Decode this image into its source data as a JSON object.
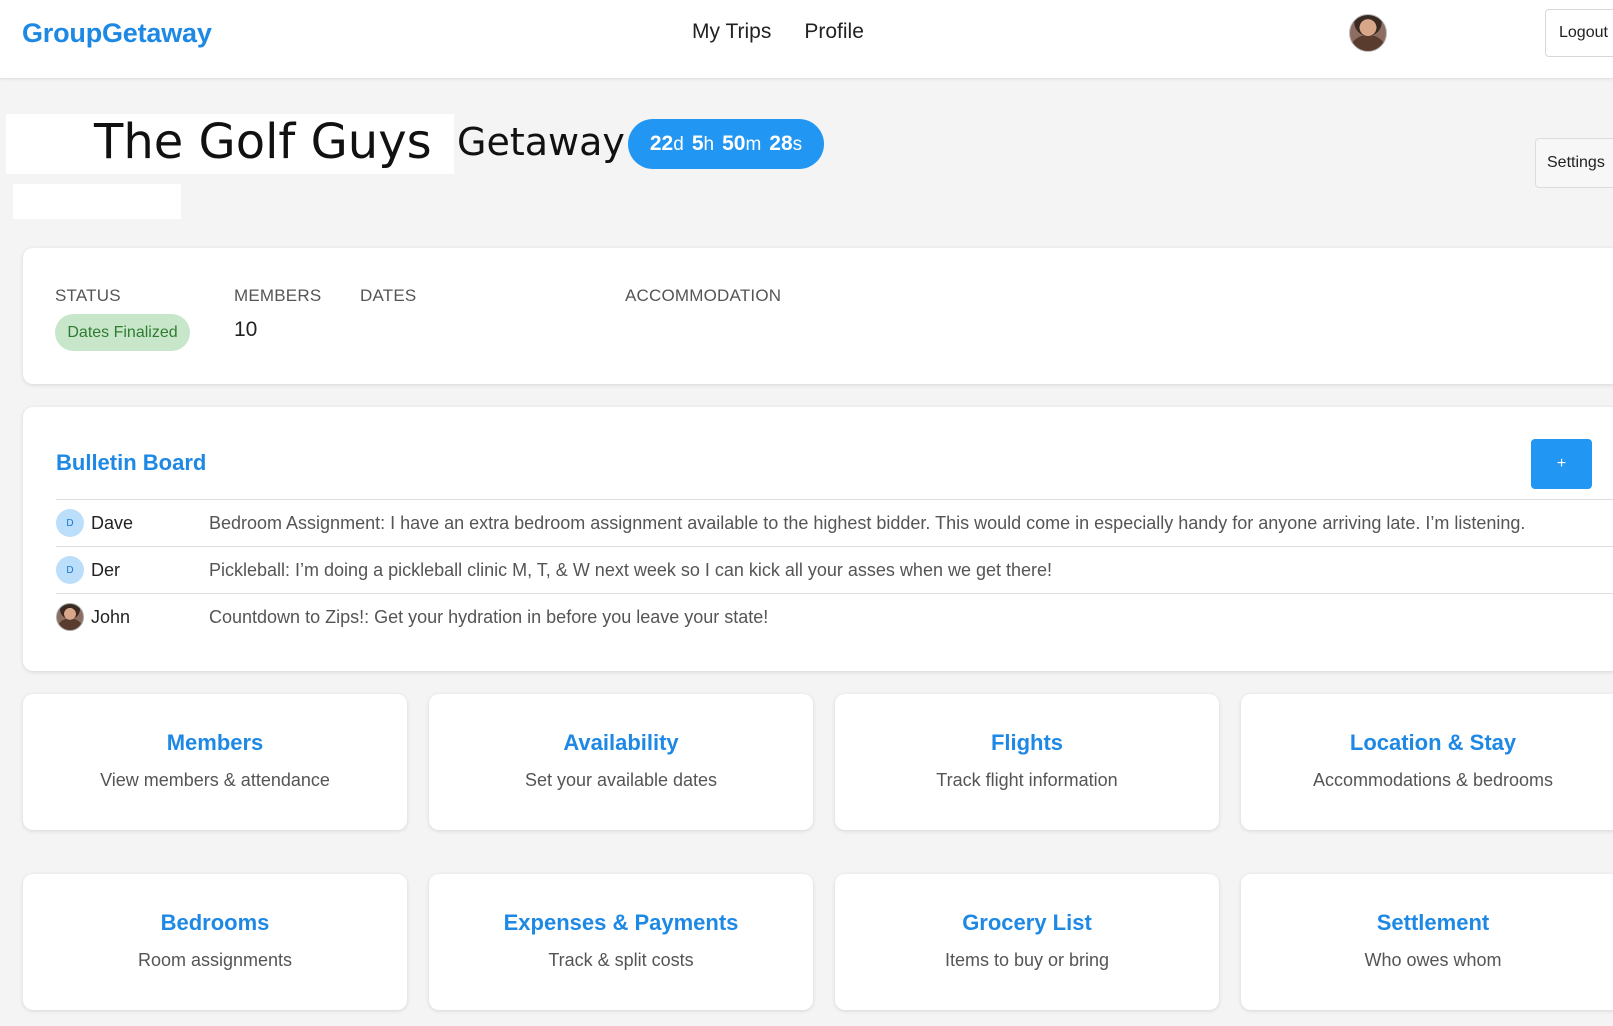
{
  "header": {
    "brand": "GroupGetaway",
    "nav": [
      "My Trips",
      "Profile"
    ],
    "logout_label": "Logout",
    "avatar_icon": "user-avatar-photo"
  },
  "trip": {
    "name": "The Golf Guys",
    "suffix": "Getaway",
    "countdown": {
      "days": "22",
      "days_unit": "d",
      "hours": "5",
      "hours_unit": "h",
      "minutes": "50",
      "minutes_unit": "m",
      "seconds": "28",
      "seconds_unit": "s"
    },
    "settings_label": "Settings"
  },
  "info": {
    "status_label": "STATUS",
    "status_value": "Dates Finalized",
    "members_label": "MEMBERS",
    "members_value": "10",
    "dates_label": "DATES",
    "accommodation_label": "ACCOMMODATION"
  },
  "bulletin": {
    "title": "Bulletin Board",
    "add_label": "+",
    "posts": [
      {
        "initial": "D",
        "name": "Dave",
        "message": "Bedroom Assignment: I have an extra bedroom assignment available to the highest bidder. This would come in especially handy for anyone arriving late. I’m listening."
      },
      {
        "initial": "D",
        "name": "Der",
        "message": "Pickleball: I’m doing a pickleball clinic M, T, & W next week so I can kick all your asses when we get there!"
      },
      {
        "initial": "",
        "name": "John",
        "message": "Countdown to Zips!: Get your hydration in before you leave your state!"
      }
    ]
  },
  "tiles": [
    {
      "title": "Members",
      "desc": "View members & attendance"
    },
    {
      "title": "Availability",
      "desc": "Set your available dates"
    },
    {
      "title": "Flights",
      "desc": "Track flight information"
    },
    {
      "title": "Location & Stay",
      "desc": "Accommodations & bedrooms"
    },
    {
      "title": "Bedrooms",
      "desc": "Room assignments"
    },
    {
      "title": "Expenses & Payments",
      "desc": "Track & split costs"
    },
    {
      "title": "Grocery List",
      "desc": "Items to buy or bring"
    },
    {
      "title": "Settlement",
      "desc": "Who owes whom"
    }
  ],
  "colors": {
    "accent": "#1e88e5",
    "button": "#2196f3",
    "status_bg": "#c8e6c9",
    "status_text": "#2e7d32",
    "page_bg": "#f4f4f4"
  }
}
